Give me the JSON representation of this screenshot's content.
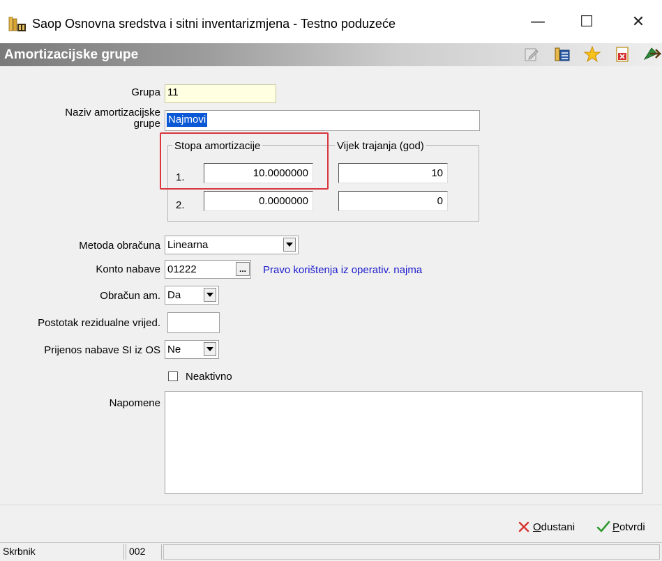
{
  "window": {
    "title": "Saop Osnovna sredstva i sitni inventarizmjena  - Testno poduzeće",
    "minimize": "—",
    "maximize": "☐",
    "close": "✕"
  },
  "header": {
    "title": "Amortizacijske grupe",
    "icons": [
      "edit-icon",
      "columns-icon",
      "favorite-star-icon",
      "pdf-export-icon",
      "exit-icon"
    ]
  },
  "form": {
    "grupa_label": "Grupa",
    "grupa_value": "11",
    "naziv_label_1": "Naziv amortizacijske",
    "naziv_label_2": "grupe",
    "naziv_value": "Najmovi",
    "stopa_legend": "Stopa amortizacije",
    "vijek_legend": "Vijek trajanja (god)",
    "row1_label": "1.",
    "row1_stopa": "10.0000000",
    "row1_vijek": "10",
    "row2_label": "2.",
    "row2_stopa": "0.0000000",
    "row2_vijek": "0",
    "metoda_label": "Metoda obračuna",
    "metoda_value": "Linearna",
    "konto_label": "Konto nabave",
    "konto_value": "01222",
    "konto_browse": "...",
    "konto_desc": "Pravo korištenja iz operativ. najma",
    "obracun_label": "Obračun am.",
    "obracun_value": "Da",
    "postotak_label": "Postotak rezidualne vrijed.",
    "postotak_value": "",
    "prijenos_label": "Prijenos nabave SI iz OS",
    "prijenos_value": "Ne",
    "neaktivno_label": "Neaktivno",
    "napomene_label": "Napomene",
    "napomene_value": ""
  },
  "buttons": {
    "odustani_u": "O",
    "odustani_rest": "dustani",
    "potvrdi_u": "P",
    "potvrdi_rest": "otvrdi"
  },
  "status": {
    "skrbnik_label": "Skrbnik",
    "skrbnik_value": "002"
  },
  "colors": {
    "highlight_box": "#d9363e",
    "link_text": "#1a1acc",
    "yellow_field": "#ffffe1",
    "selection": "#0a58d6"
  }
}
